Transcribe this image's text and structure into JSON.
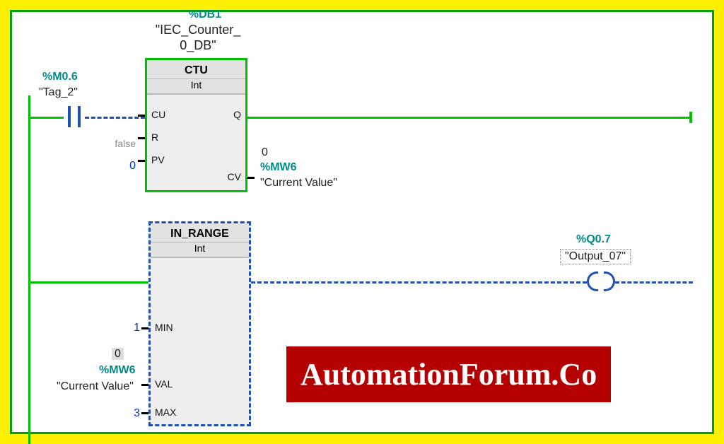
{
  "colors": {
    "frame_outer": "#ffef00",
    "frame_inner": "#00a000",
    "wire_active": "#00c000",
    "wire_dashed": "#2050b0",
    "teal": "#008b8b",
    "watermark_bg": "#b40000"
  },
  "network1": {
    "contact": {
      "address": "%M0.6",
      "tag": "\"Tag_2\""
    },
    "instance_db": {
      "address": "%DB1",
      "name_line1": "\"IEC_Counter_",
      "name_line2": "0_DB\""
    },
    "block": {
      "title": "CTU",
      "subtitle": "Int",
      "pins_left": [
        {
          "name": "CU",
          "value": "",
          "value_class": ""
        },
        {
          "name": "R",
          "value": "false",
          "value_class": "gray"
        },
        {
          "name": "PV",
          "value": "0",
          "value_class": "blue"
        }
      ],
      "pins_right": [
        {
          "name": "Q",
          "value": "",
          "address": ""
        },
        {
          "name": "CV",
          "value": "0",
          "address": "%MW6",
          "tag": "\"Current Value\""
        }
      ]
    }
  },
  "network2": {
    "block": {
      "title": "IN_RANGE",
      "subtitle": "Int",
      "pins_left": [
        {
          "name": "MIN",
          "value": "1",
          "value_class": "blue"
        },
        {
          "name": "VAL",
          "value": "0",
          "address": "%MW6",
          "tag": "\"Current Value\"",
          "value_class": "hl"
        },
        {
          "name": "MAX",
          "value": "3",
          "value_class": "blue"
        }
      ]
    },
    "coil": {
      "address": "%Q0.7",
      "tag": "\"Output_07\""
    }
  },
  "watermark": "AutomationForum.Co"
}
